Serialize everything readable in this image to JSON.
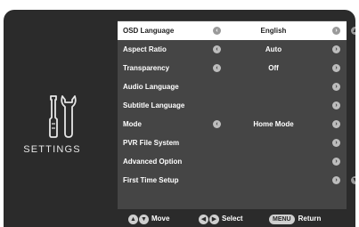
{
  "sidebar": {
    "label": "SETTINGS",
    "icon": "wrench-screwdriver-icon"
  },
  "menu": {
    "items": [
      {
        "label": "OSD Language",
        "value": "English",
        "left_arrow": true,
        "right_arrow": true,
        "selected": true
      },
      {
        "label": "Aspect Ratio",
        "value": "Auto",
        "left_arrow": true,
        "right_arrow": true,
        "selected": false
      },
      {
        "label": "Transparency",
        "value": "Off",
        "left_arrow": true,
        "right_arrow": true,
        "selected": false
      },
      {
        "label": "Audio Language",
        "value": "",
        "left_arrow": false,
        "right_arrow": true,
        "selected": false
      },
      {
        "label": "Subtitle Language",
        "value": "",
        "left_arrow": false,
        "right_arrow": true,
        "selected": false
      },
      {
        "label": "Mode",
        "value": "Home Mode",
        "left_arrow": true,
        "right_arrow": true,
        "selected": false
      },
      {
        "label": "PVR File System",
        "value": "",
        "left_arrow": false,
        "right_arrow": true,
        "selected": false
      },
      {
        "label": "Advanced Option",
        "value": "",
        "left_arrow": false,
        "right_arrow": true,
        "selected": false
      },
      {
        "label": "First Time Setup",
        "value": "",
        "left_arrow": false,
        "right_arrow": true,
        "selected": false
      }
    ],
    "scroll_up": "▲",
    "scroll_down": "▼"
  },
  "footer": {
    "move": {
      "glyphs": [
        "▲",
        "▼"
      ],
      "label": "Move"
    },
    "select": {
      "glyphs": [
        "◀",
        "▶"
      ],
      "label": "Select"
    },
    "return": {
      "button": "MENU",
      "label": "Return"
    }
  },
  "colors": {
    "background": "#2b2b2b",
    "menu": "#454545",
    "selected_row": "#ffffff",
    "text": "#ffffff"
  }
}
